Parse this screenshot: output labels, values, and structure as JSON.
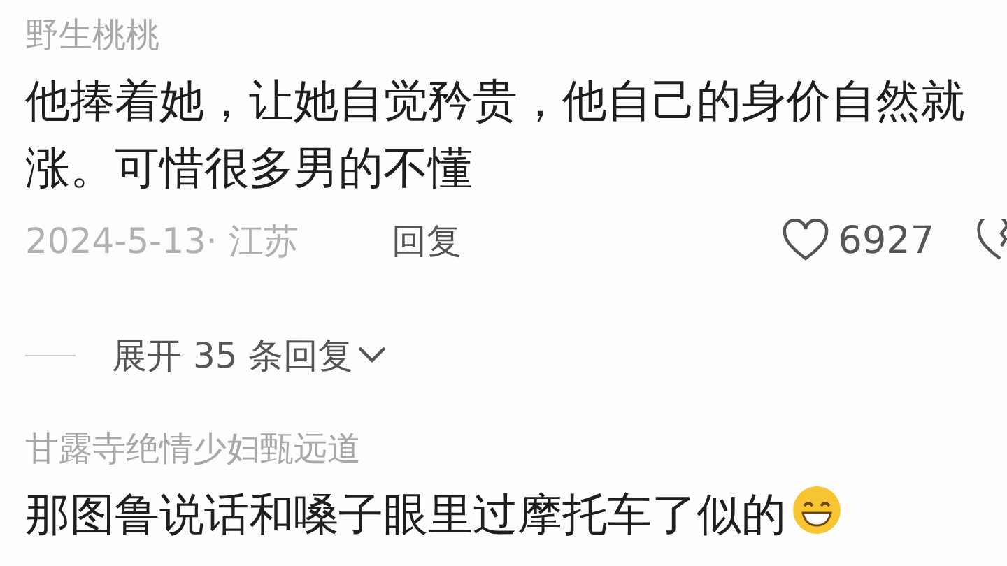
{
  "comments": [
    {
      "author": "野生桃桃",
      "text": "他捧着她，让她自觉矜贵，他自己的身价自然就涨。可惜很多男的不懂",
      "meta": "2024-5-13· 江苏",
      "reply": "回复",
      "likes": "6927",
      "replies_toggle": "展开 35 条回复",
      "emoji": false
    },
    {
      "author": "甘露寺绝情少妇甄远道",
      "text": "那图鲁说话和嗓子眼里过摩托车了似的",
      "emoji": true
    }
  ]
}
